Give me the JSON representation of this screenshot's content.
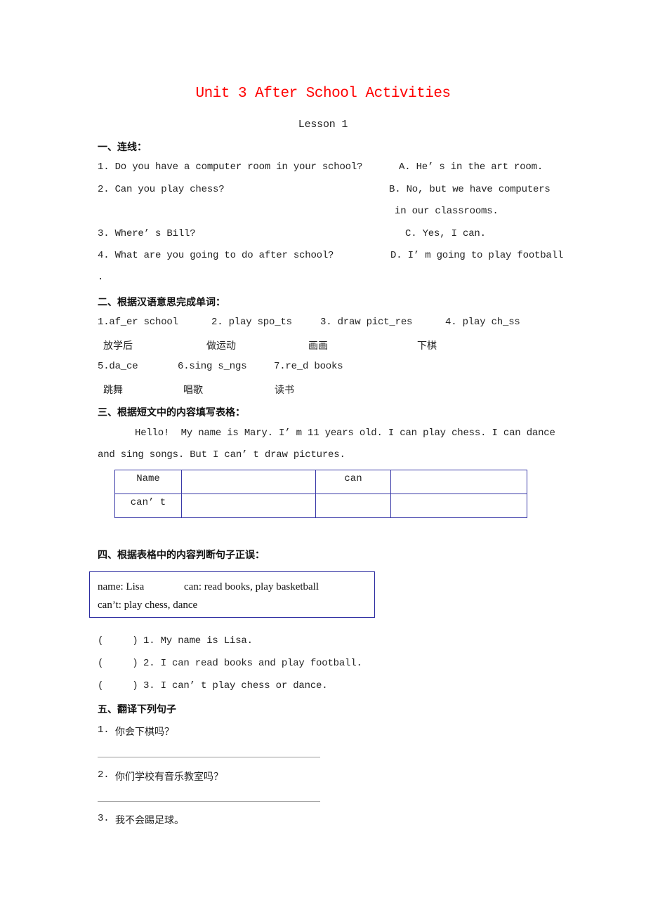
{
  "title": "Unit 3 After School Activities",
  "subtitle": "Lesson 1",
  "section1": {
    "heading": "一、连线：",
    "questions": [
      "1. Do you have a computer room in your school?",
      "2. Can you play chess?",
      "3. Where’ s Bill?",
      "4. What are you going to do after school?"
    ],
    "answers": [
      "A. He’ s in the art room.",
      "B. No, but we have computers",
      "in our classrooms.",
      "C. Yes, I can.",
      "D. I’ m going to play football"
    ],
    "trailing": "."
  },
  "section2": {
    "heading": "二、根据汉语意思完成单词：",
    "words": [
      {
        "en": "1.af_er school",
        "cn": "放学后"
      },
      {
        "en": "2. play spo_ts",
        "cn": "做运动"
      },
      {
        "en": "3. draw pict_res",
        "cn": "画画"
      },
      {
        "en": "4. play ch_ss",
        "cn": "下棋"
      },
      {
        "en": "5.da_ce",
        "cn": "跳舞"
      },
      {
        "en": "6.sing s_ngs",
        "cn": "唱歌"
      },
      {
        "en": "7.re_d books",
        "cn": "读书"
      }
    ]
  },
  "section3": {
    "heading": "三、根据短文中的内容填写表格：",
    "passage_line1": "Hello!  My name is Mary. I’ m 11 years old. I can play chess. I can dance",
    "passage_line2": "and sing songs. But I can’ t draw pictures.",
    "table": [
      [
        "Name",
        "",
        "can",
        ""
      ],
      [
        "can’ t",
        "",
        "",
        ""
      ]
    ]
  },
  "section4": {
    "heading": "四、根据表格中的内容判断句子正误：",
    "box": {
      "name": "name: Lisa",
      "can": "can: read books, play basketball",
      "cant": "can’t: play chess, dance"
    },
    "items": [
      {
        "bracket": "(     )",
        "text": "1. My name is Lisa."
      },
      {
        "bracket": "(     )",
        "text": "2. I can read books and play football."
      },
      {
        "bracket": "(     )",
        "text": "3. I can’ t play chess or dance."
      }
    ]
  },
  "section5": {
    "heading": "五、翻译下列句子",
    "items": [
      {
        "num": "1.",
        "text": "你会下棋吗？"
      },
      {
        "num": "2.",
        "text": "你们学校有音乐教室吗？"
      },
      {
        "num": "3.",
        "text": "我不会踢足球。"
      }
    ]
  }
}
